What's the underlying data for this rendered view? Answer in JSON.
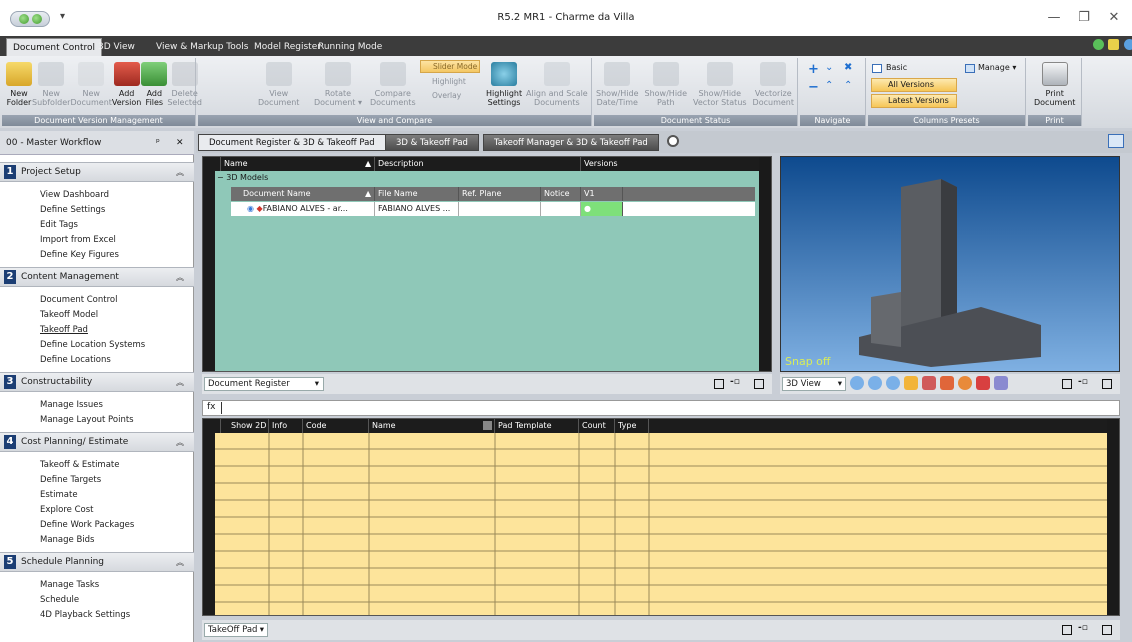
{
  "window": {
    "title": "R5.2 MR1 - Charme da Villa",
    "qat_arrow": "▾",
    "min": "—",
    "restore": "❐",
    "close": "✕"
  },
  "ribbon_tabs": [
    "Document Control",
    "3D View",
    "View & Markup Tools",
    "Model Register",
    "Running Mode"
  ],
  "ribbon": {
    "doc_version_mgmt": {
      "label": "Document Version Management",
      "buttons": [
        "New\nFolder",
        "New\nSubfolder",
        "New\nDocument",
        "Add\nVersion",
        "Add\nFiles",
        "Delete\nSelected"
      ]
    },
    "view_compare": {
      "label": "View and Compare",
      "buttons": [
        "View\nDocument",
        "Rotate\nDocument ▾",
        "Compare\nDocuments",
        "Highlight\nSettings",
        "Align and Scale\nDocuments"
      ],
      "slider_mode": "Slider Mode",
      "highlight": "Highlight",
      "overlay": "Overlay"
    },
    "document_status": {
      "label": "Document Status",
      "buttons": [
        "Show/Hide\nDate/Time",
        "Show/Hide\nPath",
        "Show/Hide\nVector Status",
        "Vectorize\nDocument"
      ]
    },
    "navigate": {
      "label": "Navigate"
    },
    "columns_presets": {
      "label": "Columns Presets",
      "basic": "Basic",
      "all_versions": "All Versions",
      "latest_versions": "Latest Versions",
      "manage": "Manage ▾"
    },
    "print": {
      "label": "Print",
      "button": "Print\nDocument"
    }
  },
  "left_pane": {
    "title": "00 - Master Workflow",
    "pin": "ᵖ",
    "close": "✕",
    "sections": [
      {
        "num": "1",
        "title": "Project Setup",
        "items": [
          "View Dashboard",
          "Define Settings",
          "Edit Tags",
          "Import from Excel",
          "Define Key Figures"
        ]
      },
      {
        "num": "2",
        "title": "Content Management",
        "items": [
          "Document Control",
          "Takeoff Model",
          "Takeoff Pad",
          "Define Location Systems",
          "Define Locations"
        ]
      },
      {
        "num": "3",
        "title": "Constructability",
        "items": [
          "Manage Issues",
          "Manage Layout Points"
        ]
      },
      {
        "num": "4",
        "title": "Cost Planning/ Estimate",
        "items": [
          "Takeoff & Estimate",
          "Define Targets",
          "Estimate",
          "Explore Cost",
          "Define Work Packages",
          "Manage Bids"
        ]
      },
      {
        "num": "5",
        "title": "Schedule Planning",
        "items": [
          "Manage Tasks",
          "Schedule",
          "4D Playback Settings"
        ]
      }
    ]
  },
  "doc_tabs": [
    "Document Register & 3D & Takeoff Pad",
    "3D & Takeoff Pad",
    "Takeoff Manager & 3D & Takeoff Pad"
  ],
  "register": {
    "columns": [
      "Name",
      "Description",
      "Versions"
    ],
    "group": "3D Models",
    "sub_columns": [
      "Document Name",
      "File Name",
      "Ref. Plane",
      "Notice",
      "V1"
    ],
    "row": {
      "name": "FABIANO ALVES - ar...",
      "file": "FABIANO ALVES ..."
    },
    "view_combo": "Document Register"
  },
  "view3d": {
    "snap": "Snap off",
    "combo": "3D View"
  },
  "takeoff": {
    "fx": "fx",
    "columns": [
      "Show 2D",
      "Info",
      "Code",
      "Name",
      "Pad Template",
      "Count",
      "Type"
    ],
    "combo": "TakeOff Pad"
  },
  "colors": {
    "teal": "#8fc8b8",
    "yellow": "#fde49b",
    "green": "#7ee07a",
    "dark": "#1c1c1c",
    "sectionNum": "#1c3e74"
  }
}
